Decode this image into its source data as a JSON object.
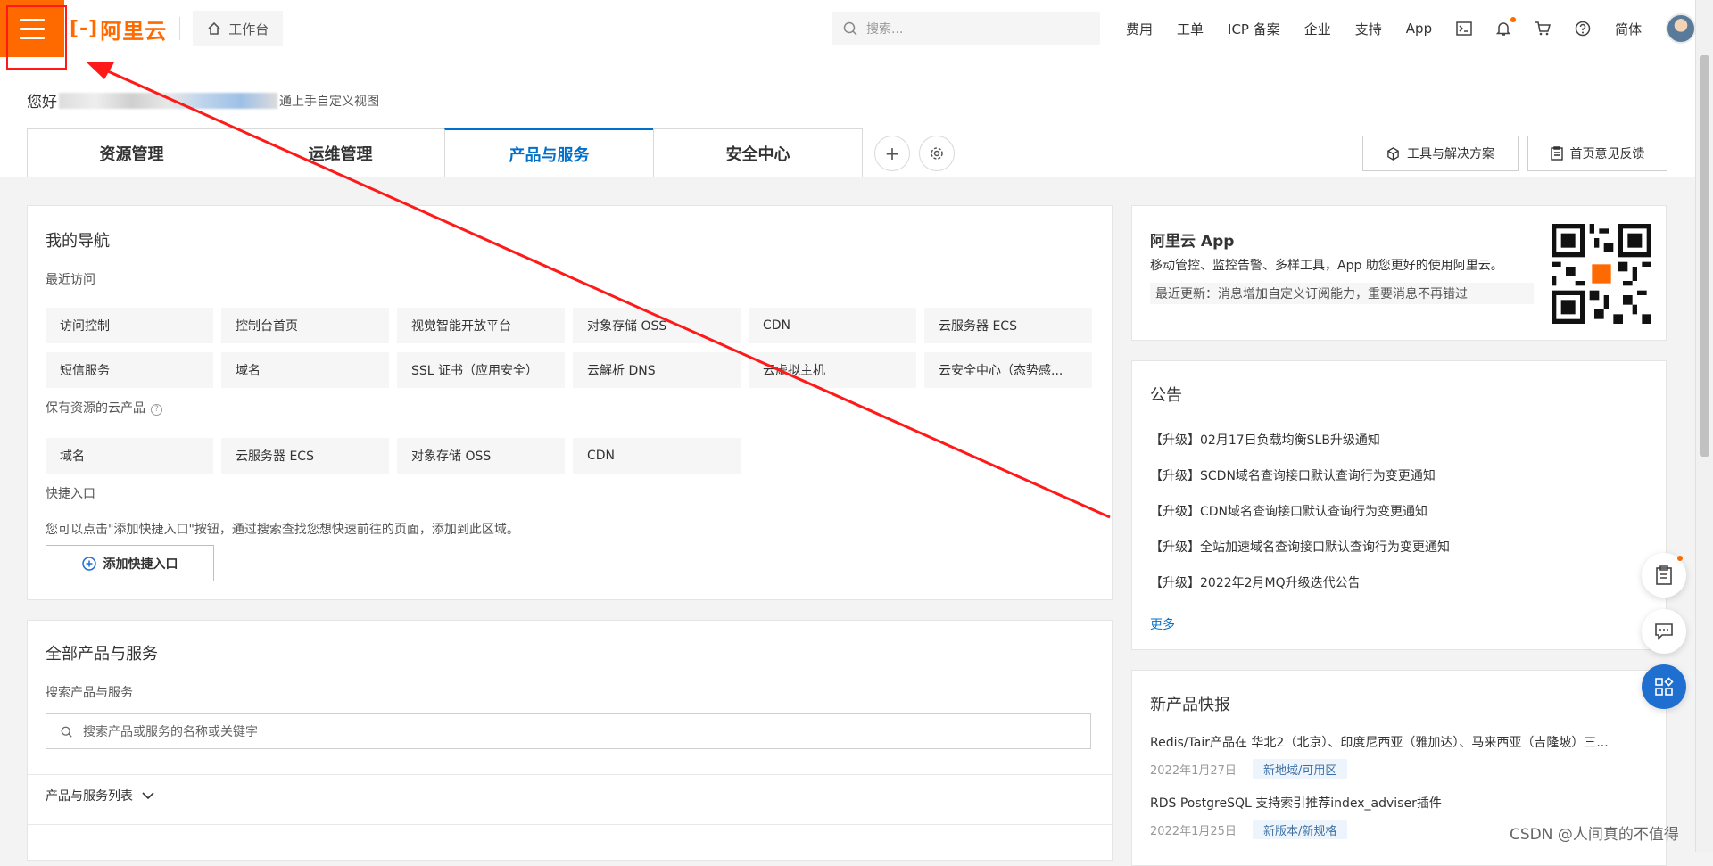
{
  "header": {
    "logo_text": "阿里云",
    "workbench_label": "工作台",
    "search_placeholder": "搜索...",
    "nav_items": [
      "费用",
      "工单",
      "ICP 备案",
      "企业",
      "支持",
      "App"
    ],
    "lang_label": "简体"
  },
  "greeting": {
    "prefix": "您好",
    "suffix": "通上手自定义视图"
  },
  "tabs": [
    "资源管理",
    "运维管理",
    "产品与服务",
    "安全中心"
  ],
  "active_tab": "产品与服务",
  "toolbar": {
    "tools_label": "工具与解决方案",
    "feedback_label": "首页意见反馈"
  },
  "my_nav": {
    "title": "我的导航",
    "recent_label": "最近访问",
    "recent_items": [
      "访问控制",
      "控制台首页",
      "视觉智能开放平台",
      "对象存储 OSS",
      "CDN",
      "云服务器 ECS",
      "短信服务",
      "域名",
      "SSL 证书（应用安全）",
      "云解析 DNS",
      "云虚拟主机",
      "云安全中心（态势感..."
    ],
    "owned_label": "保有资源的云产品",
    "owned_items": [
      "域名",
      "云服务器 ECS",
      "对象存储 OSS",
      "CDN"
    ],
    "shortcut_label": "快捷入口",
    "shortcut_hint": "您可以点击\"添加快捷入口\"按钮，通过搜索查找您想快速前往的页面，添加到此区域。",
    "add_shortcut_label": "添加快捷入口"
  },
  "all_products": {
    "title": "全部产品与服务",
    "search_label": "搜索产品与服务",
    "search_placeholder": "搜索产品或服务的名称或关键字",
    "list_label": "产品与服务列表"
  },
  "app_card": {
    "title": "阿里云 App",
    "desc": "移动管控、监控告警、多样工具，App 助您更好的使用阿里云。",
    "update": "最近更新：消息增加自定义订阅能力，重要消息不再错过"
  },
  "announcements": {
    "title": "公告",
    "items": [
      "【升级】02月17日负载均衡SLB升级通知",
      "【升级】SCDN域名查询接口默认查询行为变更通知",
      "【升级】CDN域名查询接口默认查询行为变更通知",
      "【升级】全站加速域名查询接口默认查询行为变更通知",
      "【升级】2022年2月MQ升级迭代公告"
    ],
    "more_label": "更多"
  },
  "new_products": {
    "title": "新产品快报",
    "items": [
      {
        "text": "Redis/Tair产品在 华北2（北京）、印度尼西亚（雅加达）、马来西亚（吉隆坡）三...",
        "date": "2022年1月27日",
        "tag": "新地域/可用区"
      },
      {
        "text": "RDS PostgreSQL 支持索引推荐index_adviser插件",
        "date": "2022年1月25日",
        "tag": "新版本/新规格"
      }
    ]
  },
  "watermark": "CSDN @人间真的不值得",
  "colors": {
    "brand": "#ff6a00",
    "primary": "#0070cc",
    "annotation": "#ff1a1a"
  }
}
